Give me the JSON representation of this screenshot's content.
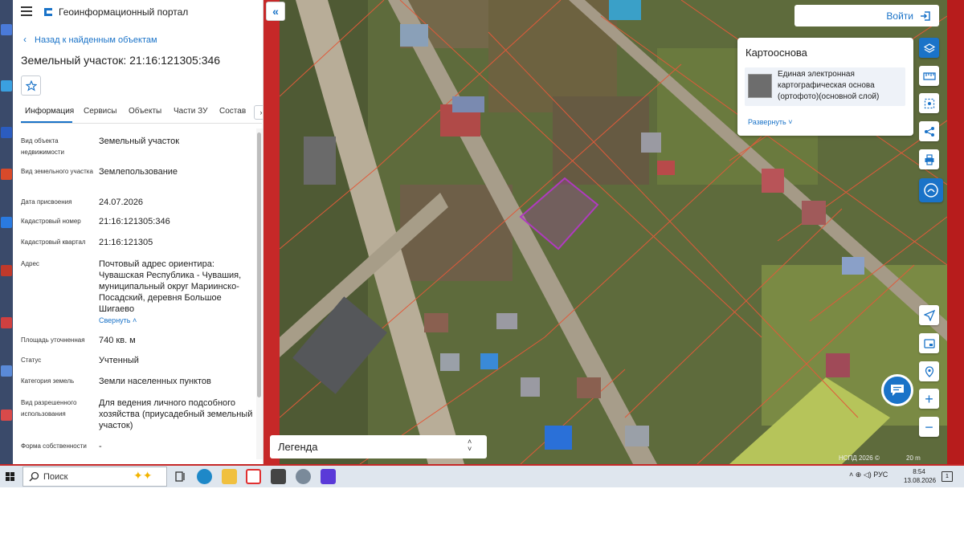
{
  "app": {
    "title": "Геоинформационный портал"
  },
  "nav": {
    "back_label": "Назад к найденным объектам"
  },
  "object": {
    "title": "Земельный участок: 21:16:121305:346"
  },
  "tabs": [
    "Информация",
    "Сервисы",
    "Объекты",
    "Части ЗУ",
    "Состав"
  ],
  "attributes": [
    {
      "label": "Вид объекта недвижимости",
      "value": "Земельный участок"
    },
    {
      "label": "Вид земельного участка",
      "value": "Землепользование"
    },
    {
      "label": "Дата присвоения",
      "value": "24.07.2026"
    },
    {
      "label": "Кадастровый номер",
      "value": "21:16:121305:346"
    },
    {
      "label": "Кадастровый квартал",
      "value": "21:16:121305"
    },
    {
      "label": "Адрес",
      "value": "Почтовый адрес ориентира: Чувашская Республика - Чувашия, муниципальный округ Мариинско-Посадский, деревня Большое Шигаево"
    },
    {
      "label": "Площадь уточненная",
      "value": "740 кв. м"
    },
    {
      "label": "Статус",
      "value": "Учтенный"
    },
    {
      "label": "Категория земель",
      "value": "Земли населенных пунктов"
    },
    {
      "label": "Вид разрешенного использования",
      "value": "Для ведения личного подсобного хозяйства (приусадебный земельный участок)"
    },
    {
      "label": "Форма собственности",
      "value": "-"
    }
  ],
  "address_collapse_label": "Свернуть",
  "login": {
    "label": "Войти"
  },
  "basemap": {
    "title": "Картооснова",
    "item": "Единая электронная картографическая основа (ортофото)(основной слой)",
    "expand_label": "Развернуть"
  },
  "legend": {
    "label": "Легенда"
  },
  "map_footer": {
    "copyright": "НСПД 2026 ©",
    "scale": "20 m"
  },
  "taskbar": {
    "search_label": "Поиск",
    "language": "РУС",
    "time": "8:54",
    "date": "13.08.2026",
    "notifications": "1"
  },
  "colors": {
    "accent": "#1a73c8",
    "parcel_outline": "#e05a3a",
    "selected_parcel": "#b03ac0",
    "screen_border": "#c62828"
  },
  "icons": {
    "menu": "hamburger-icon",
    "logo": "portal-logo-icon",
    "collapse": "double-chevron-left-icon",
    "favorite": "star-icon",
    "login": "login-icon",
    "tools": [
      "layers-icon",
      "ruler-icon",
      "select-area-icon",
      "share-icon",
      "print-icon",
      "chat-bot-icon",
      "navigate-icon",
      "minimap-icon",
      "locate-icon",
      "zoom-in-icon",
      "zoom-out-icon"
    ]
  }
}
